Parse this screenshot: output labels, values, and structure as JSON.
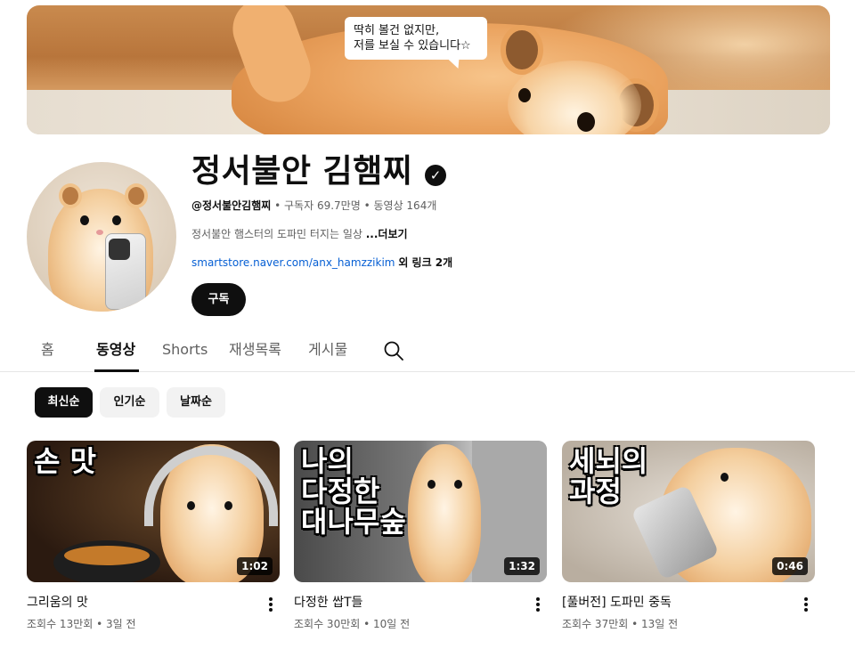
{
  "banner": {
    "speech_bubble": [
      "딱히 볼건 없지만,",
      "저를 보실 수 있습니다☆"
    ]
  },
  "channel": {
    "name": "정서불안 김햄찌",
    "verified_icon": "check-badge-icon",
    "handle": "@정서불안김햄찌",
    "subscribers": "구독자 69.7만명",
    "video_count": "동영상 164개",
    "separator": "•",
    "description": "정서불안 햄스터의 도파민 터지는 일상",
    "more_label": "...더보기",
    "link_url": "smartstore.naver.com/anx_hamzzikim",
    "link_extra": "외 링크 2개",
    "subscribe_label": "구독"
  },
  "tabs": [
    {
      "label": "홈",
      "active": false
    },
    {
      "label": "동영상",
      "active": true
    },
    {
      "label": "Shorts",
      "active": false
    },
    {
      "label": "재생목록",
      "active": false
    },
    {
      "label": "게시물",
      "active": false
    }
  ],
  "chips": [
    {
      "label": "최신순",
      "active": true
    },
    {
      "label": "인기순",
      "active": false
    },
    {
      "label": "날짜순",
      "active": false
    }
  ],
  "videos": [
    {
      "thumb_text": "손 맛",
      "duration": "1:02",
      "title": "그리움의 맛",
      "views": "조회수 13만회",
      "age": "3일 전"
    },
    {
      "thumb_text": "나의\n다정한\n대나무숲",
      "duration": "1:32",
      "title": "다정한 쌉T들",
      "views": "조회수 30만회",
      "age": "10일 전"
    },
    {
      "thumb_text": "세뇌의\n과정",
      "duration": "0:46",
      "title": "[풀버전] 도파민 중독",
      "views": "조회수 37만회",
      "age": "13일 전"
    }
  ],
  "colors": {
    "text_primary": "#0f0f0f",
    "text_secondary": "#606060",
    "link": "#065fd4",
    "chip_bg": "#f2f2f2"
  }
}
